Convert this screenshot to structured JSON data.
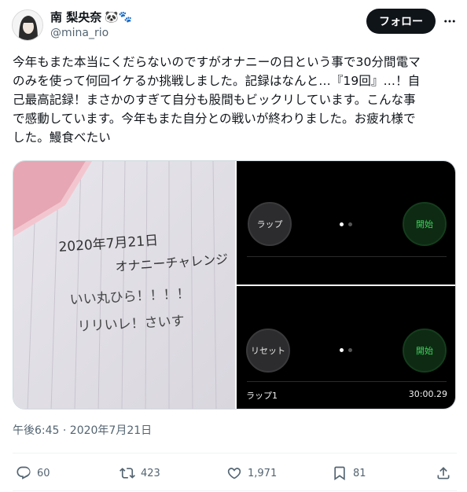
{
  "user": {
    "display_name": "南 梨央奈",
    "emoji": "🐼🐾",
    "handle": "@mina_rio"
  },
  "follow_label": "フォロー",
  "tweet": {
    "lines": [
      "今年もまた本当にくだらないのですがオナニーの日という事で30分間電マ",
      "のみを使って何回イケるか挑戦しました。記録はなんと…『19回』…！自",
      "己最高記録！まさかのすぎて自分も股間もビックリしています。こんな事",
      "で感動しています。今年もまた自分との戦いが終わりました。お疲れ様で",
      "した。鰻食べたい"
    ]
  },
  "media": {
    "note": {
      "line1": "2020年7月21日",
      "line2": "オナニーチャレンジ",
      "tally_rows": [
        "いい丸ひら！！！！",
        "リリいレ！さいす"
      ]
    },
    "stopwatch_top": {
      "left_button": "ラップ",
      "right_button": "開始"
    },
    "stopwatch_bottom": {
      "left_button": "リセット",
      "right_button": "開始",
      "lap_label": "ラップ1",
      "lap_time": "30:00.29"
    }
  },
  "timestamp": "午後6:45 · 2020年7月21日",
  "metrics": {
    "replies": "60",
    "retweets": "423",
    "likes": "1,971",
    "bookmarks": "81"
  },
  "colors": {
    "text": "#0f1419",
    "secondary": "#536471",
    "follow_bg": "#0f1419",
    "stopwatch_green": "#3fd15c"
  }
}
